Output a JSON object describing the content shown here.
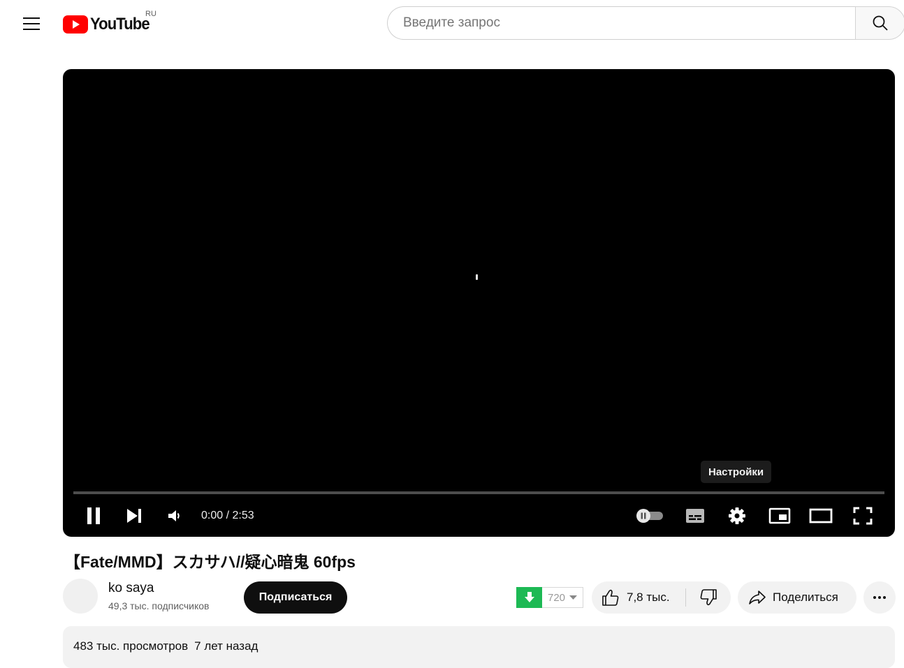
{
  "header": {
    "logo_text": "YouTube",
    "region": "RU",
    "search_placeholder": "Введите запрос"
  },
  "player": {
    "tooltip": "Настройки",
    "time": "0:00 / 2:53",
    "progress_fraction": 0.0,
    "controls": [
      "pause-icon",
      "next-icon",
      "volume-icon",
      "autoplay-toggle",
      "subtitles-icon",
      "settings-icon",
      "miniplayer-icon",
      "theater-icon",
      "fullscreen-icon"
    ]
  },
  "video": {
    "title": "【Fate/MMD】スカサハ//疑心暗鬼 60fps"
  },
  "channel": {
    "name": "ko saya",
    "subscribers": "49,3 тыс. подписчиков",
    "subscribe_label": "Подписаться"
  },
  "actions": {
    "download_quality": "720",
    "likes": "7,8 тыс.",
    "share_label": "Поделиться"
  },
  "description": {
    "views": "483 тыс. просмотров",
    "age": "7 лет назад"
  },
  "colors": {
    "brand_red": "#ff0000",
    "download_green": "#1db954",
    "subscribe_bg": "#0f0f0f"
  }
}
